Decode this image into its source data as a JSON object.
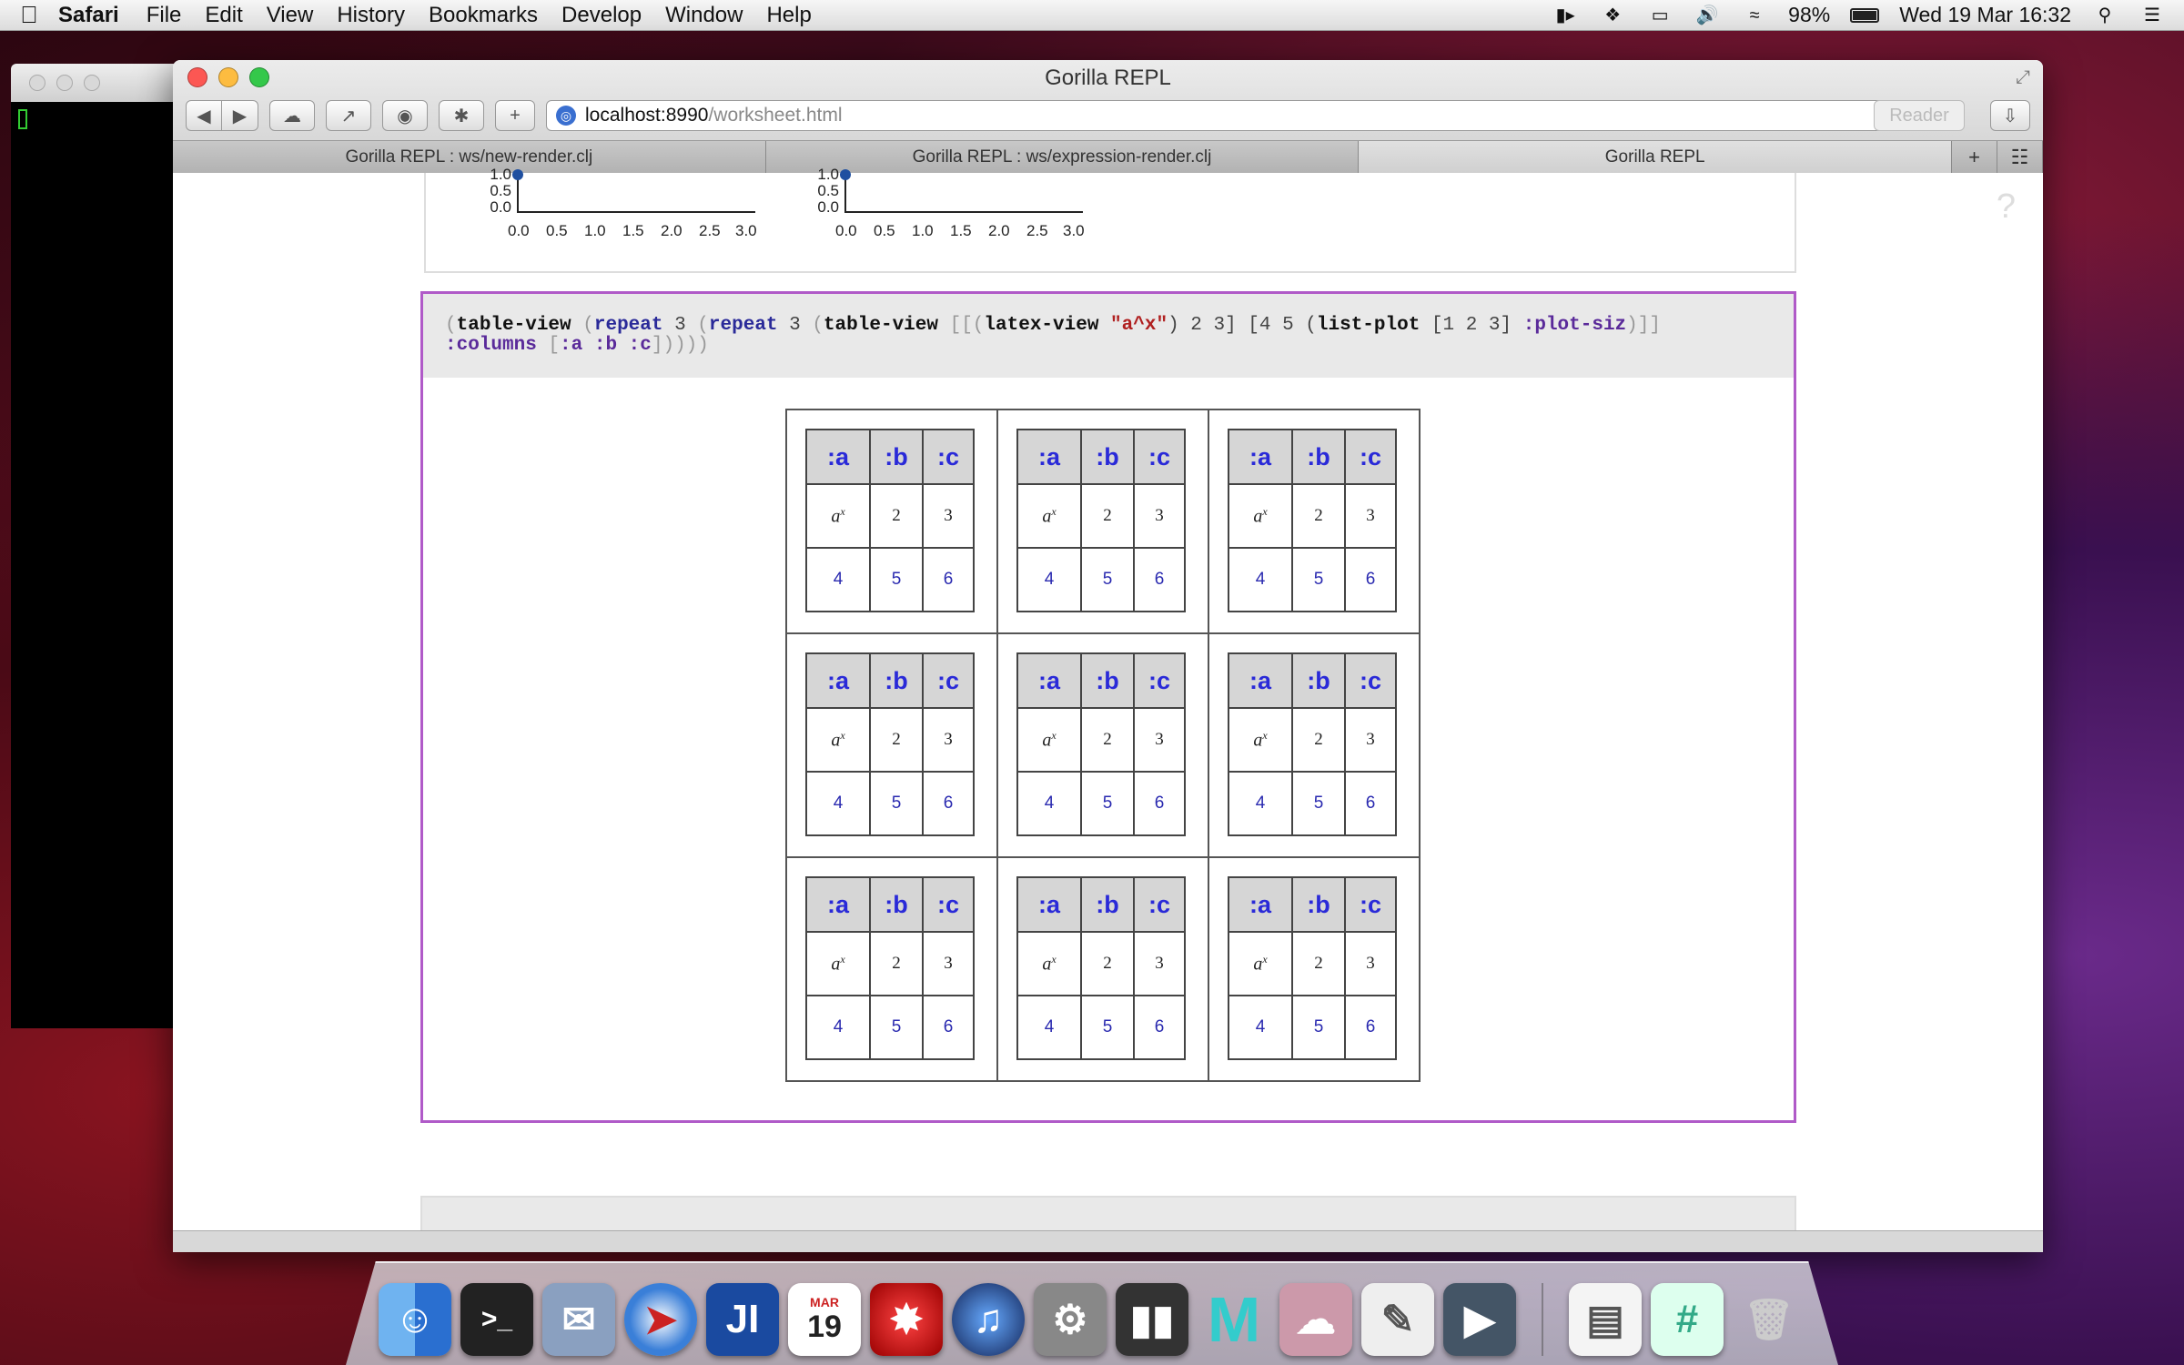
{
  "menubar": {
    "apple": "",
    "app": "Safari",
    "items": [
      "File",
      "Edit",
      "View",
      "History",
      "Bookmarks",
      "Develop",
      "Window",
      "Help"
    ],
    "battery": "98%",
    "datetime": "Wed 19 Mar  16:32"
  },
  "browser": {
    "title": "Gorilla REPL",
    "url_host": "localhost:8990",
    "url_path": "/worksheet.html",
    "reader": "Reader",
    "tabs": [
      "Gorilla REPL : ws/new-render.clj",
      "Gorilla REPL : ws/expression-render.clj",
      "Gorilla REPL"
    ],
    "new_tab": "+"
  },
  "help_icon": "?",
  "prev_plot": {
    "y_ticks": [
      "1.0",
      "0.5",
      "0.0"
    ],
    "x_ticks": [
      "0.0",
      "0.5",
      "1.0",
      "1.5",
      "2.0",
      "2.5",
      "3.0"
    ]
  },
  "cell": {
    "code_line1_parts": [
      "(",
      "table-view",
      " (",
      "repeat",
      " 3 ",
      "(",
      "repeat",
      " 3 ",
      "(",
      "table-view",
      " [[(",
      "latex-view",
      " ",
      "\"a^x\"",
      ") 2 3] [4 5 (",
      "list-plot",
      " [1 2 3] ",
      ":plot-siz",
      ")]]"
    ],
    "code_line2_parts": [
      ":columns",
      " [",
      ":a :b :c",
      "]))))"
    ]
  },
  "table": {
    "headers": [
      ":a",
      ":b",
      ":c"
    ],
    "row1": {
      "latex_base": "a",
      "latex_exp": "x",
      "b": "2",
      "c": "3"
    },
    "row2": [
      "4",
      "5",
      "6"
    ]
  },
  "dock": {
    "icons": [
      "finder-icon",
      "terminal-icon",
      "mail-icon",
      "safari-icon",
      "intellij-icon",
      "calendar-icon",
      "redshift-icon",
      "itunes-icon",
      "system-preferences-icon",
      "audio-icon",
      "mathematica-icon",
      "photos-icon",
      "textedit-icon",
      "quicktime-icon",
      "documents-icon",
      "numbers-icon",
      "trash-icon"
    ],
    "calendar_day": "19",
    "calendar_month": "MAR",
    "intellij_label": "JI",
    "m_label": "M",
    "hash_label": "#"
  }
}
